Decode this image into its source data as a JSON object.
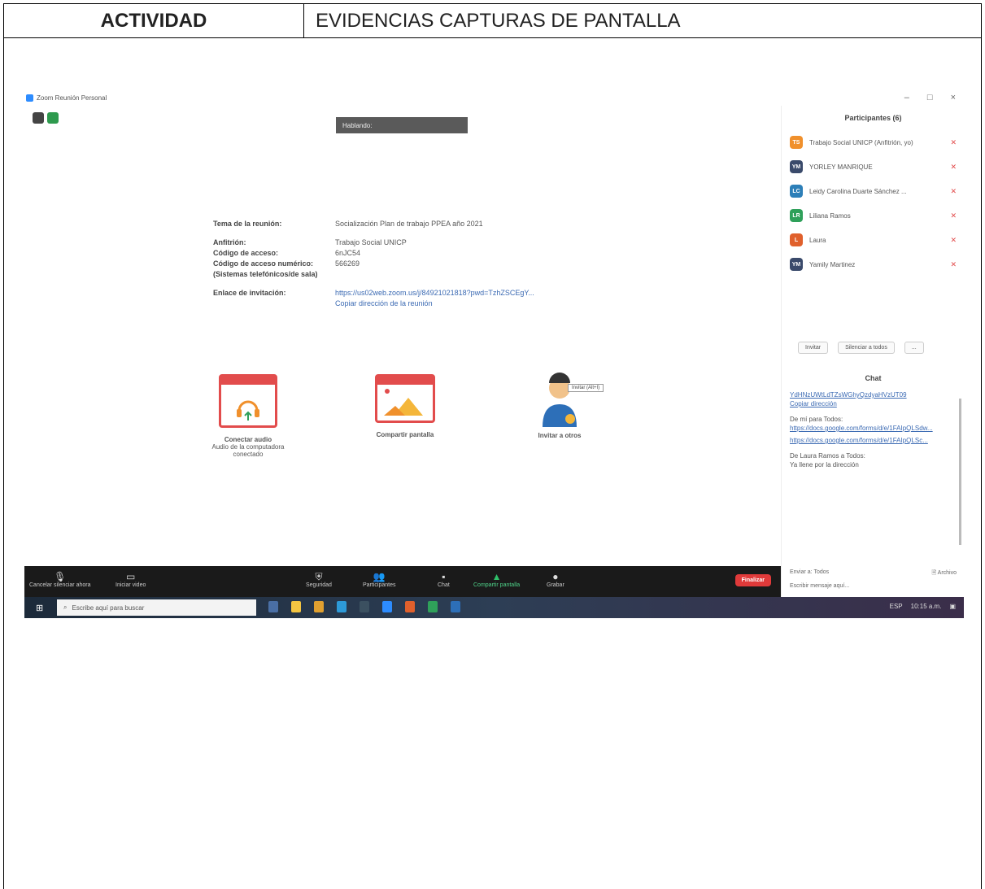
{
  "header": {
    "left_label": "ACTIVIDAD",
    "right_label": "EVIDENCIAS CAPTURAS DE PANTALLA"
  },
  "screenshot": {
    "window_title": "Zoom Reunión Personal",
    "tooltip": "Hablando:",
    "info": {
      "topic_label": "Tema de la reunión:",
      "topic_value": "Socialización Plan de trabajo PPEA año 2021",
      "host_label": "Anfitrión:",
      "host_value": "Trabajo Social UNICP",
      "code_label": "Código de acceso:",
      "code_value": "6nJC54",
      "numeric_label": "Código de acceso numérico:",
      "numeric_value": "566269",
      "phone_label": "(Sistemas telefónicos/de sala)",
      "invite_label": "Enlace de invitación:",
      "invite_value": "https://us02web.zoom.us/j/84921021818?pwd=TzhZSCEgY...",
      "copy_link": "Copiar dirección de la reunión"
    },
    "tiles": [
      {
        "label": "Conectar audio",
        "sub": "Audio de la computadora conectado"
      },
      {
        "label": "Compartir pantalla",
        "sub": ""
      },
      {
        "label": "Invitar a otros",
        "sub": ""
      }
    ],
    "avatar_tag": "Invitar (Alt+I)",
    "panel": {
      "title": "Participantes (6)",
      "participants": [
        {
          "initials": "TS",
          "name": "Trabajo Social UNICP (Anfitrión, yo)",
          "color": "#f0902c"
        },
        {
          "initials": "YM",
          "name": "YORLEY MANRIQUE",
          "color": "#3a4a6b"
        },
        {
          "initials": "LC",
          "name": "Leidy Carolina Duarte Sánchez ...",
          "color": "#2d7fb8"
        },
        {
          "initials": "LR",
          "name": "Liliana Ramos",
          "color": "#2fa05a"
        },
        {
          "initials": "L",
          "name": "Laura",
          "color": "#e0602c"
        },
        {
          "initials": "YM",
          "name": "Yamily Martinez",
          "color": "#3a4a6b"
        }
      ],
      "invite_btn": "Invitar",
      "mute_all_btn": "Silenciar a todos",
      "more_btn": "...",
      "chat_title": "Chat",
      "chat_lines": [
        {
          "text": "YdHNzUWtLdTZsWGhyQzdyaHVzUT09",
          "link": true
        },
        {
          "text": "Copiar dirección",
          "link": true
        },
        {
          "text": "De mí para Todos:",
          "link": false
        },
        {
          "text": "https://docs.google.com/forms/d/e/1FAIpQLSdw...",
          "link": true
        },
        {
          "text": "https://docs.google.com/forms/d/e/1FAIpQLSc...",
          "link": true
        },
        {
          "text": "De Laura Ramos a Todos:",
          "link": false
        },
        {
          "text": "Ya llene por la dirección",
          "link": false
        }
      ],
      "chat_to": "Enviar a: Todos",
      "file_btn": "Archivo",
      "chat_placeholder": "Escribir mensaje aquí..."
    },
    "toolbar": {
      "items": [
        {
          "label": "Cancelar silenciar ahora",
          "icon": "mic-icon"
        },
        {
          "label": "Iniciar video",
          "icon": "video-icon"
        },
        {
          "label": "Seguridad",
          "icon": "shield-icon"
        },
        {
          "label": "Participantes",
          "icon": "participants-icon"
        },
        {
          "label": "Chat",
          "icon": "chat-icon"
        },
        {
          "label": "Compartir pantalla",
          "icon": "share-icon"
        },
        {
          "label": "Grabar",
          "icon": "record-icon"
        }
      ],
      "end_label": "Finalizar"
    },
    "taskbar": {
      "search_placeholder": "Escribe aquí para buscar",
      "tray_text": "ESP",
      "time": "10:15 a.m."
    }
  }
}
